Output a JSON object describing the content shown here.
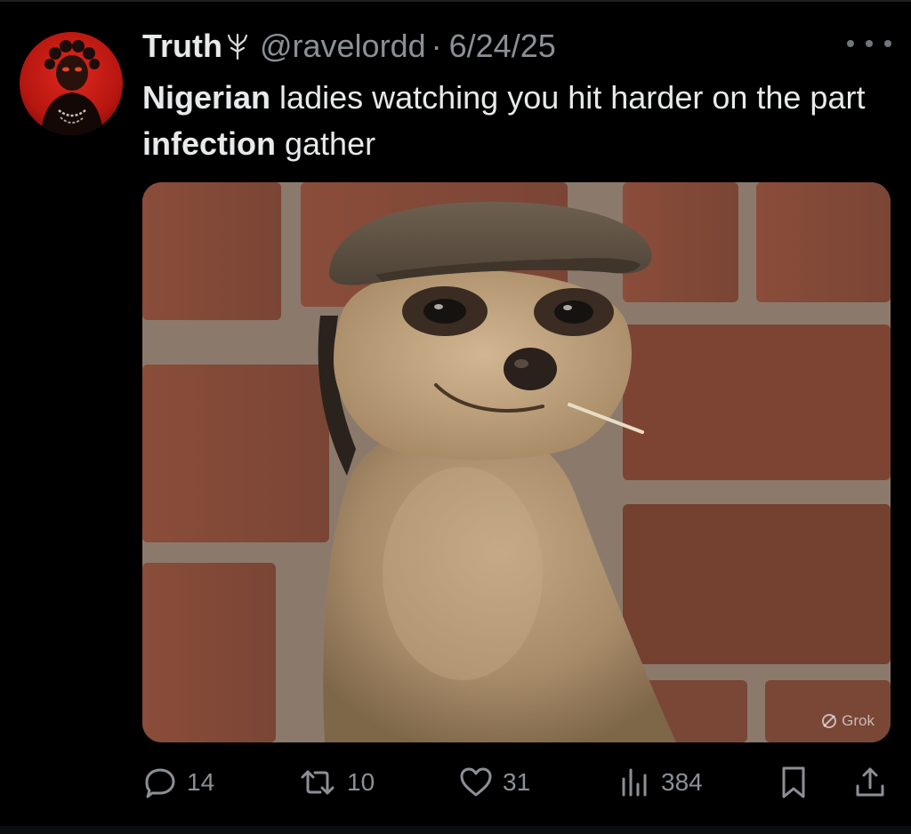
{
  "tweet": {
    "author_name": "Truth",
    "name_emoji": "tree-emoji",
    "handle": "@ravelordd",
    "separator": "·",
    "date": "6/24/25",
    "text_parts": [
      {
        "text": "Nigerian",
        "bold": true
      },
      {
        "text": " ladies watching you hit harder on the part ",
        "bold": false
      },
      {
        "text": "infection",
        "bold": true
      },
      {
        "text": " gather",
        "bold": false
      }
    ],
    "media_watermark": "Grok"
  },
  "actions": {
    "reply_count": "14",
    "retweet_count": "10",
    "like_count": "31",
    "views_count": "384"
  },
  "icons": {
    "reply": "reply-icon",
    "retweet": "retweet-icon",
    "like": "heart-icon",
    "views": "views-icon",
    "bookmark": "bookmark-icon",
    "share": "share-icon",
    "more": "more-icon"
  },
  "colors": {
    "background": "#000000",
    "text": "#e7e9ea",
    "muted": "#8b9095",
    "avatar_bg": "#c81f16"
  }
}
